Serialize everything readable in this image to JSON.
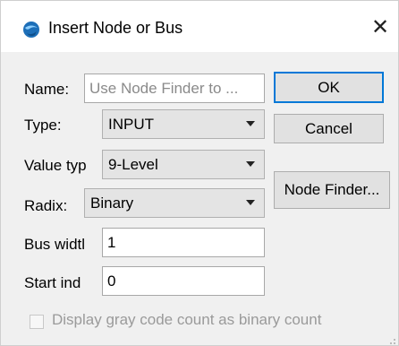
{
  "window": {
    "title": "Insert Node or Bus",
    "close_glyph": "✕",
    "app_icon": "quartus-globe-icon"
  },
  "form": {
    "name_label": "Name:",
    "name_placeholder": "Use Node Finder to ...",
    "name_value": "",
    "type_label": "Type:",
    "type_value": "INPUT",
    "value_type_label": "Value typ",
    "value_type_value": "9-Level",
    "radix_label": "Radix:",
    "radix_value": "Binary",
    "bus_width_label": "Bus widtl",
    "bus_width_value": "1",
    "start_index_label": "Start ind",
    "start_index_value": "0"
  },
  "buttons": {
    "ok": "OK",
    "cancel": "Cancel",
    "node_finder": "Node Finder..."
  },
  "checkbox": {
    "label": "Display gray code count as binary count",
    "checked": false,
    "enabled": false
  },
  "colors": {
    "dialog_bg": "#f0f0f0",
    "default_button_border": "#0078d7",
    "disabled_text": "#9a9a9a"
  }
}
